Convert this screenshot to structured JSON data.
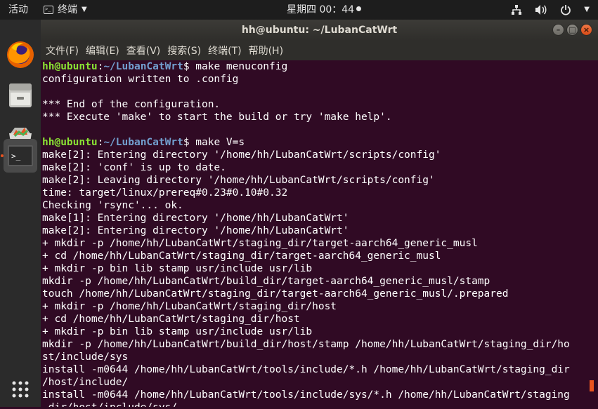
{
  "topbar": {
    "activities": "活动",
    "app_name": "终端",
    "clock": "星期四 00：44",
    "icons": [
      "network-icon",
      "volume-icon",
      "power-icon",
      "chevron-down-icon"
    ]
  },
  "dock": {
    "items": [
      "firefox-icon",
      "files-icon",
      "software-icon",
      "terminal-icon",
      "show-apps-icon"
    ],
    "accent": "#e95420"
  },
  "window": {
    "title": "hh@ubuntu: ~/LubanCatWrt",
    "buttons": {
      "minimize": "–",
      "maximize": "□",
      "close": "×"
    }
  },
  "menubar": {
    "items": [
      "文件(F)",
      "编辑(E)",
      "查看(V)",
      "搜索(S)",
      "终端(T)",
      "帮助(H)"
    ]
  },
  "terminal": {
    "user_host": "hh@ubuntu",
    "path": "~/LubanCatWrt",
    "prompt_sym": "$ ",
    "cmd1": "make menuconfig",
    "cmd2": "make V=s",
    "lines": [
      "configuration written to .config",
      "",
      "*** End of the configuration.",
      "*** Execute 'make' to start the build or try 'make help'.",
      "",
      "make[2]: Entering directory '/home/hh/LubanCatWrt/scripts/config'",
      "make[2]: 'conf' is up to date.",
      "make[2]: Leaving directory '/home/hh/LubanCatWrt/scripts/config'",
      "time: target/linux/prereq#0.23#0.10#0.32",
      "Checking 'rsync'... ok.",
      "make[1]: Entering directory '/home/hh/LubanCatWrt'",
      "make[2]: Entering directory '/home/hh/LubanCatWrt'",
      "+ mkdir -p /home/hh/LubanCatWrt/staging_dir/target-aarch64_generic_musl",
      "+ cd /home/hh/LubanCatWrt/staging_dir/target-aarch64_generic_musl",
      "+ mkdir -p bin lib stamp usr/include usr/lib",
      "mkdir -p /home/hh/LubanCatWrt/build_dir/target-aarch64_generic_musl/stamp",
      "touch /home/hh/LubanCatWrt/staging_dir/target-aarch64_generic_musl/.prepared",
      "+ mkdir -p /home/hh/LubanCatWrt/staging_dir/host",
      "+ cd /home/hh/LubanCatWrt/staging_dir/host",
      "+ mkdir -p bin lib stamp usr/include usr/lib",
      "mkdir -p /home/hh/LubanCatWrt/build_dir/host/stamp /home/hh/LubanCatWrt/staging_dir/ho",
      "st/include/sys",
      "install -m0644 /home/hh/LubanCatWrt/tools/include/*.h /home/hh/LubanCatWrt/staging_dir",
      "/host/include/",
      "install -m0644 /home/hh/LubanCatWrt/tools/include/sys/*.h /home/hh/LubanCatWrt/staging",
      "_dir/host/include/sys/"
    ]
  }
}
